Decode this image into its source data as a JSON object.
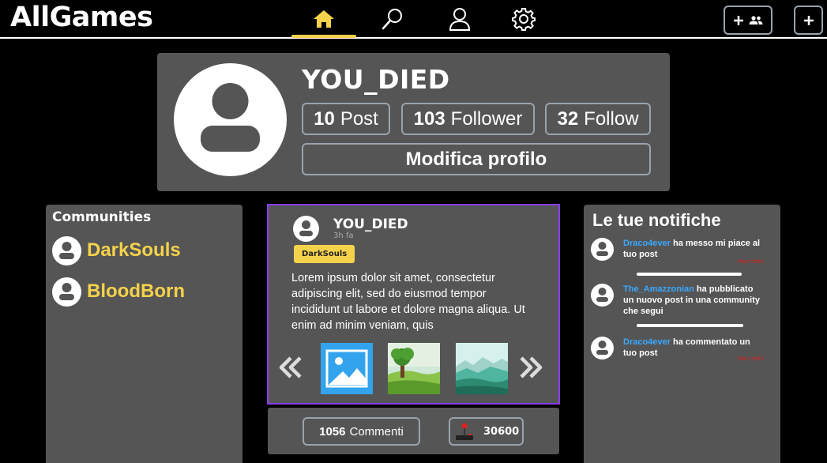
{
  "app": {
    "title": "AllGames"
  },
  "nav": {
    "items": [
      {
        "name": "home",
        "icon": "home-icon",
        "active": true
      },
      {
        "name": "search",
        "icon": "search-icon",
        "active": false
      },
      {
        "name": "profile",
        "icon": "user-icon",
        "active": false
      },
      {
        "name": "settings",
        "icon": "gear-icon",
        "active": false
      }
    ],
    "active_color": "#f5d24b"
  },
  "header_buttons": [
    {
      "name": "add-group",
      "icons": [
        "plus-icon",
        "group-icon"
      ]
    },
    {
      "name": "add",
      "icons": [
        "plus-icon"
      ]
    }
  ],
  "profile": {
    "username": "YOU_DIED",
    "stats": {
      "posts_count": "10",
      "posts_label": "Post",
      "followers_count": "103",
      "followers_label": "Follower",
      "following_count": "32",
      "following_label": "Follow"
    },
    "edit_label": "Modifica profilo"
  },
  "communities": {
    "title": "Communities",
    "items": [
      {
        "name": "DarkSouls"
      },
      {
        "name": "BloodBorn"
      }
    ],
    "name_color": "#f5d24b"
  },
  "post": {
    "author": "YOU_DIED",
    "time": "3h fa",
    "tag": "DarkSouls",
    "text": "Lorem ipsum dolor sit amet, consectetur adipiscing elit, sed do eiusmod tempor incididunt ut labore et dolore magna aliqua. Ut enim ad minim veniam, quis",
    "images": [
      "image-placeholder-icon",
      "tree-landscape",
      "mountain-landscape"
    ],
    "border_color": "#8a3cf0",
    "comments_count": "1056",
    "comments_label": "Commenti",
    "score": "30600"
  },
  "notifications": {
    "title": "Le tue notifiche",
    "items": [
      {
        "user": "Draco4ever",
        "text": " ha messo mi piace al tuo post",
        "read_label": "Non letto"
      },
      {
        "user": "The_Amazzonian",
        "text": " ha pubblicato un nuovo post in una community che segui",
        "read_label": ""
      },
      {
        "user": "Draco4ever",
        "text": " ha commentato un tuo post",
        "read_label": "Non letto"
      }
    ],
    "user_color": "#3aa8ff"
  }
}
